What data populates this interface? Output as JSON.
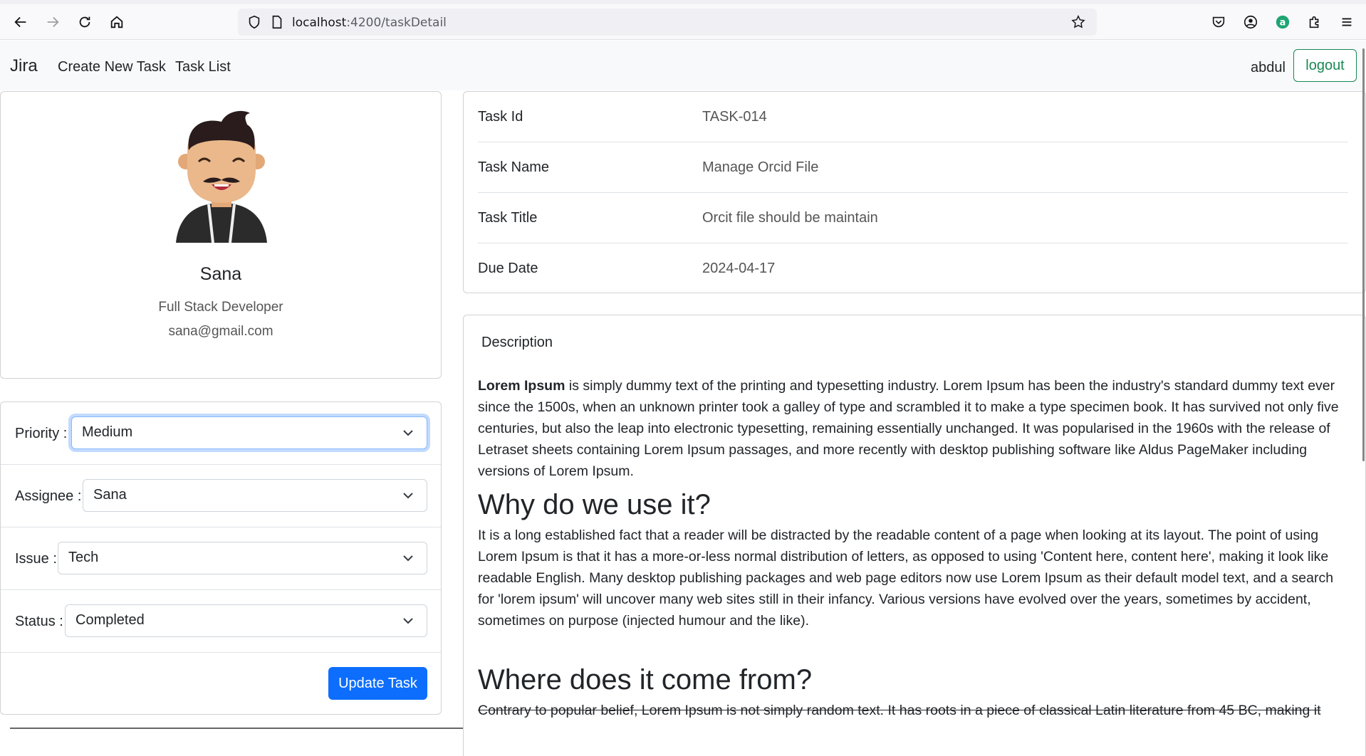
{
  "browser": {
    "url_host": "localhost",
    "url_path": ":4200/taskDetail"
  },
  "navbar": {
    "brand": "Jira",
    "links": [
      "Create New Task",
      "Task List"
    ],
    "username": "abdul",
    "logout_label": "logout"
  },
  "profile": {
    "name": "Sana",
    "role": "Full Stack Developer",
    "email": "sana@gmail.com"
  },
  "form": {
    "priority_label": "Priority :",
    "priority_value": "Medium",
    "assignee_label": "Assignee :",
    "assignee_value": "Sana",
    "issue_label": "Issue :",
    "issue_value": "Tech",
    "status_label": "Status :",
    "status_value": "Completed",
    "update_label": "Update Task"
  },
  "details": {
    "rows": [
      {
        "key": "Task Id",
        "value": "TASK-014"
      },
      {
        "key": "Task Name",
        "value": "Manage Orcid File"
      },
      {
        "key": "Task Title",
        "value": "Orcit file should be maintain"
      },
      {
        "key": "Due Date",
        "value": "2024-04-17"
      }
    ]
  },
  "description": {
    "title": "Description",
    "p1_bold": "Lorem Ipsum",
    "p1_rest": " is simply dummy text of the printing and typesetting industry. Lorem Ipsum has been the industry's standard dummy text ever since the 1500s, when an unknown printer took a galley of type and scrambled it to make a type specimen book. It has survived not only five centuries, but also the leap into electronic typesetting, remaining essentially unchanged. It was popularised in the 1960s with the release of Letraset sheets containing Lorem Ipsum passages, and more recently with desktop publishing software like Aldus PageMaker including versions of Lorem Ipsum.",
    "h1": "Why do we use it?",
    "p2": "It is a long established fact that a reader will be distracted by the readable content of a page when looking at its layout. The point of using Lorem Ipsum is that it has a more-or-less normal distribution of letters, as opposed to using 'Content here, content here', making it look like readable English. Many desktop publishing packages and web page editors now use Lorem Ipsum as their default model text, and a search for 'lorem ipsum' will uncover many web sites still in their infancy. Various versions have evolved over the years, sometimes by accident, sometimes on purpose (injected humour and the like).",
    "h2": "Where does it come from?",
    "p3": "Contrary to popular belief, Lorem Ipsum is not simply random text. It has roots in a piece of classical Latin literature from 45 BC, making it"
  }
}
